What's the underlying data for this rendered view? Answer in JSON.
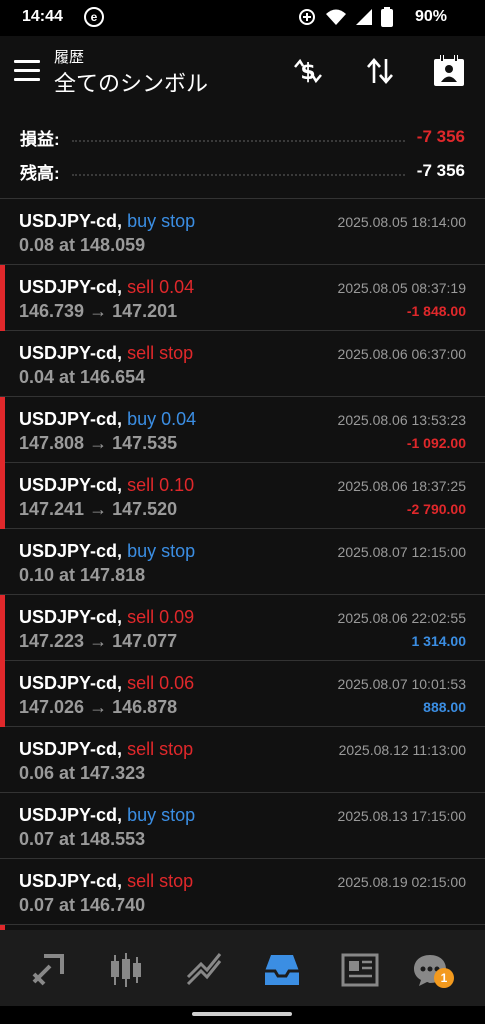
{
  "status_bar": {
    "time": "14:44",
    "app_icon_letter": "e",
    "battery": "90%"
  },
  "header": {
    "subtitle": "履歴",
    "title": "全てのシンボル"
  },
  "summary": {
    "profit_label": "損益:",
    "profit_value": "-7 356",
    "balance_label": "残高:",
    "balance_value": "-7 356"
  },
  "colors": {
    "buy": "#3b8ee3",
    "sell": "#e0282b",
    "accent_bar": "#e0282b",
    "badge": "#f39a1e"
  },
  "orders": [
    {
      "symbol": "USDJPY-cd,",
      "type": "buy stop",
      "detail": "0.08 at 148.059",
      "time": "2025.08.05 18:14:00",
      "pl": ""
    },
    {
      "symbol": "USDJPY-cd,",
      "type": "sell 0.04",
      "detail": "146.739 → 147.201",
      "time": "2025.08.05 08:37:19",
      "pl": "-1 848.00"
    },
    {
      "symbol": "USDJPY-cd,",
      "type": "sell stop",
      "detail": "0.04 at 146.654",
      "time": "2025.08.06 06:37:00",
      "pl": ""
    },
    {
      "symbol": "USDJPY-cd,",
      "type": "buy 0.04",
      "detail": "147.808 → 147.535",
      "time": "2025.08.06 13:53:23",
      "pl": "-1 092.00"
    },
    {
      "symbol": "USDJPY-cd,",
      "type": "sell 0.10",
      "detail": "147.241 → 147.520",
      "time": "2025.08.06 18:37:25",
      "pl": "-2 790.00"
    },
    {
      "symbol": "USDJPY-cd,",
      "type": "buy stop",
      "detail": "0.10 at 147.818",
      "time": "2025.08.07 12:15:00",
      "pl": ""
    },
    {
      "symbol": "USDJPY-cd,",
      "type": "sell 0.09",
      "detail": "147.223 → 147.077",
      "time": "2025.08.06 22:02:55",
      "pl": "1 314.00"
    },
    {
      "symbol": "USDJPY-cd,",
      "type": "sell 0.06",
      "detail": "147.026 → 146.878",
      "time": "2025.08.07 10:01:53",
      "pl": "888.00"
    },
    {
      "symbol": "USDJPY-cd,",
      "type": "sell stop",
      "detail": "0.06 at 147.323",
      "time": "2025.08.12 11:13:00",
      "pl": ""
    },
    {
      "symbol": "USDJPY-cd,",
      "type": "buy stop",
      "detail": "0.07 at 148.553",
      "time": "2025.08.13 17:15:00",
      "pl": ""
    },
    {
      "symbol": "USDJPY-cd,",
      "type": "sell stop",
      "detail": "0.07 at 146.740",
      "time": "2025.08.19 02:15:00",
      "pl": ""
    }
  ],
  "bottom_nav": {
    "chat_badge": "1",
    "active": "history"
  }
}
